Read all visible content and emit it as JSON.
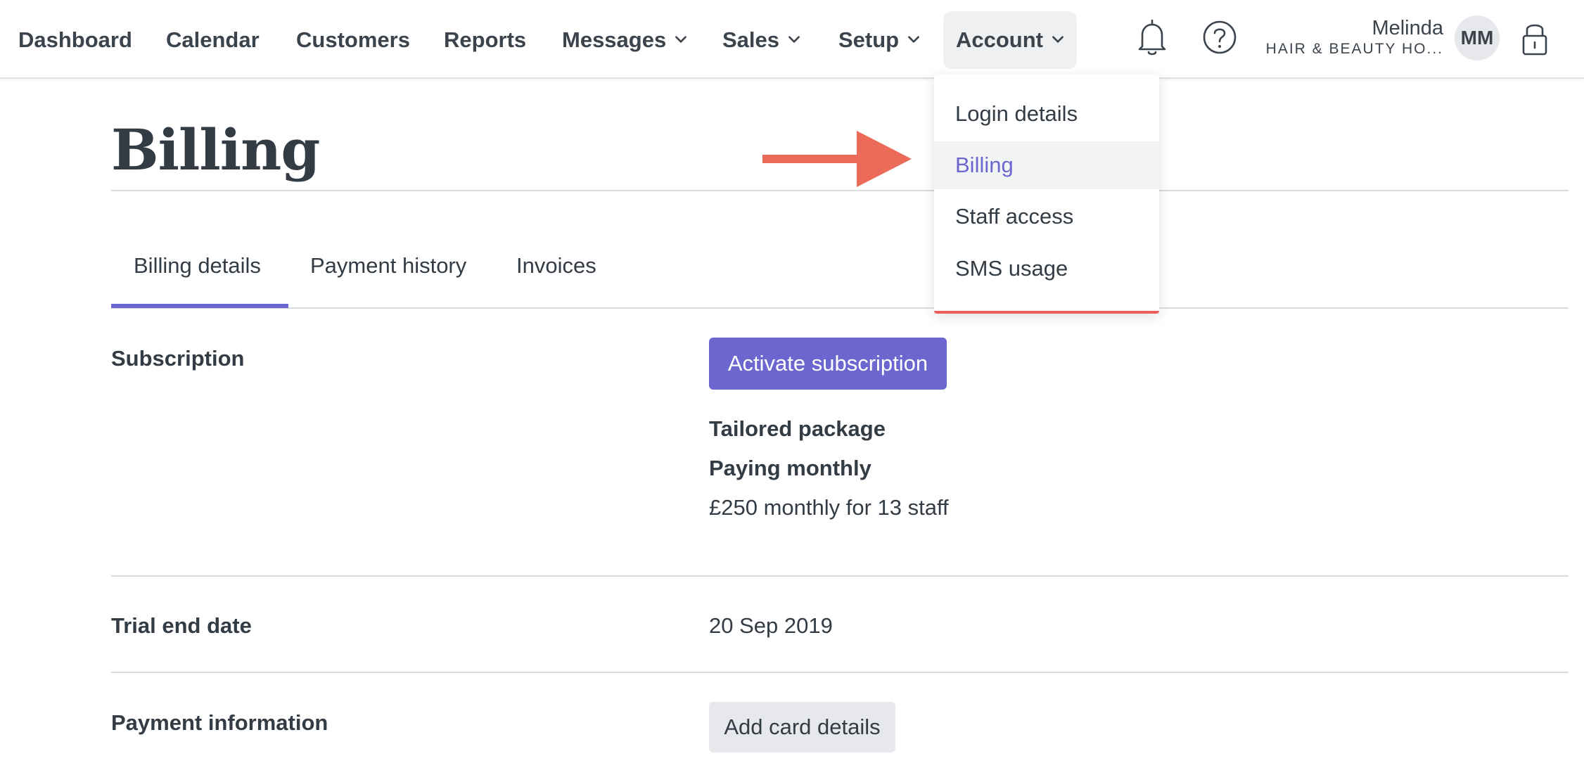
{
  "nav": {
    "items": [
      {
        "label": "Dashboard",
        "has_chevron": false
      },
      {
        "label": "Calendar",
        "has_chevron": false
      },
      {
        "label": "Customers",
        "has_chevron": false
      },
      {
        "label": "Reports",
        "has_chevron": false
      },
      {
        "label": "Messages",
        "has_chevron": true
      },
      {
        "label": "Sales",
        "has_chevron": true
      },
      {
        "label": "Setup",
        "has_chevron": true
      },
      {
        "label": "Account",
        "has_chevron": true,
        "active": true
      }
    ],
    "icons": [
      "bell-icon",
      "help-circle-icon",
      "lock-icon"
    ]
  },
  "user": {
    "name": "Melinda",
    "org": "HAIR & BEAUTY HO...",
    "initials": "MM"
  },
  "account_menu": {
    "items": [
      {
        "label": "Login details"
      },
      {
        "label": "Billing",
        "selected": true
      },
      {
        "label": "Staff access"
      },
      {
        "label": "SMS usage"
      }
    ]
  },
  "page": {
    "title": "Billing",
    "tabs": [
      {
        "label": "Billing details",
        "active": true
      },
      {
        "label": "Payment history"
      },
      {
        "label": "Invoices"
      }
    ]
  },
  "billing": {
    "subscription": {
      "label": "Subscription",
      "button": "Activate subscription",
      "package": "Tailored package",
      "frequency": "Paying monthly",
      "price": "£250 monthly for 13 staff"
    },
    "trial": {
      "label": "Trial end date",
      "value": "20 Sep 2019"
    },
    "payment": {
      "label": "Payment information",
      "button": "Add card details"
    }
  },
  "colors": {
    "accent": "#6b67cf",
    "arrow": "#ec6a58",
    "text": "#333b44",
    "dropdown_border": "#e9615a"
  }
}
